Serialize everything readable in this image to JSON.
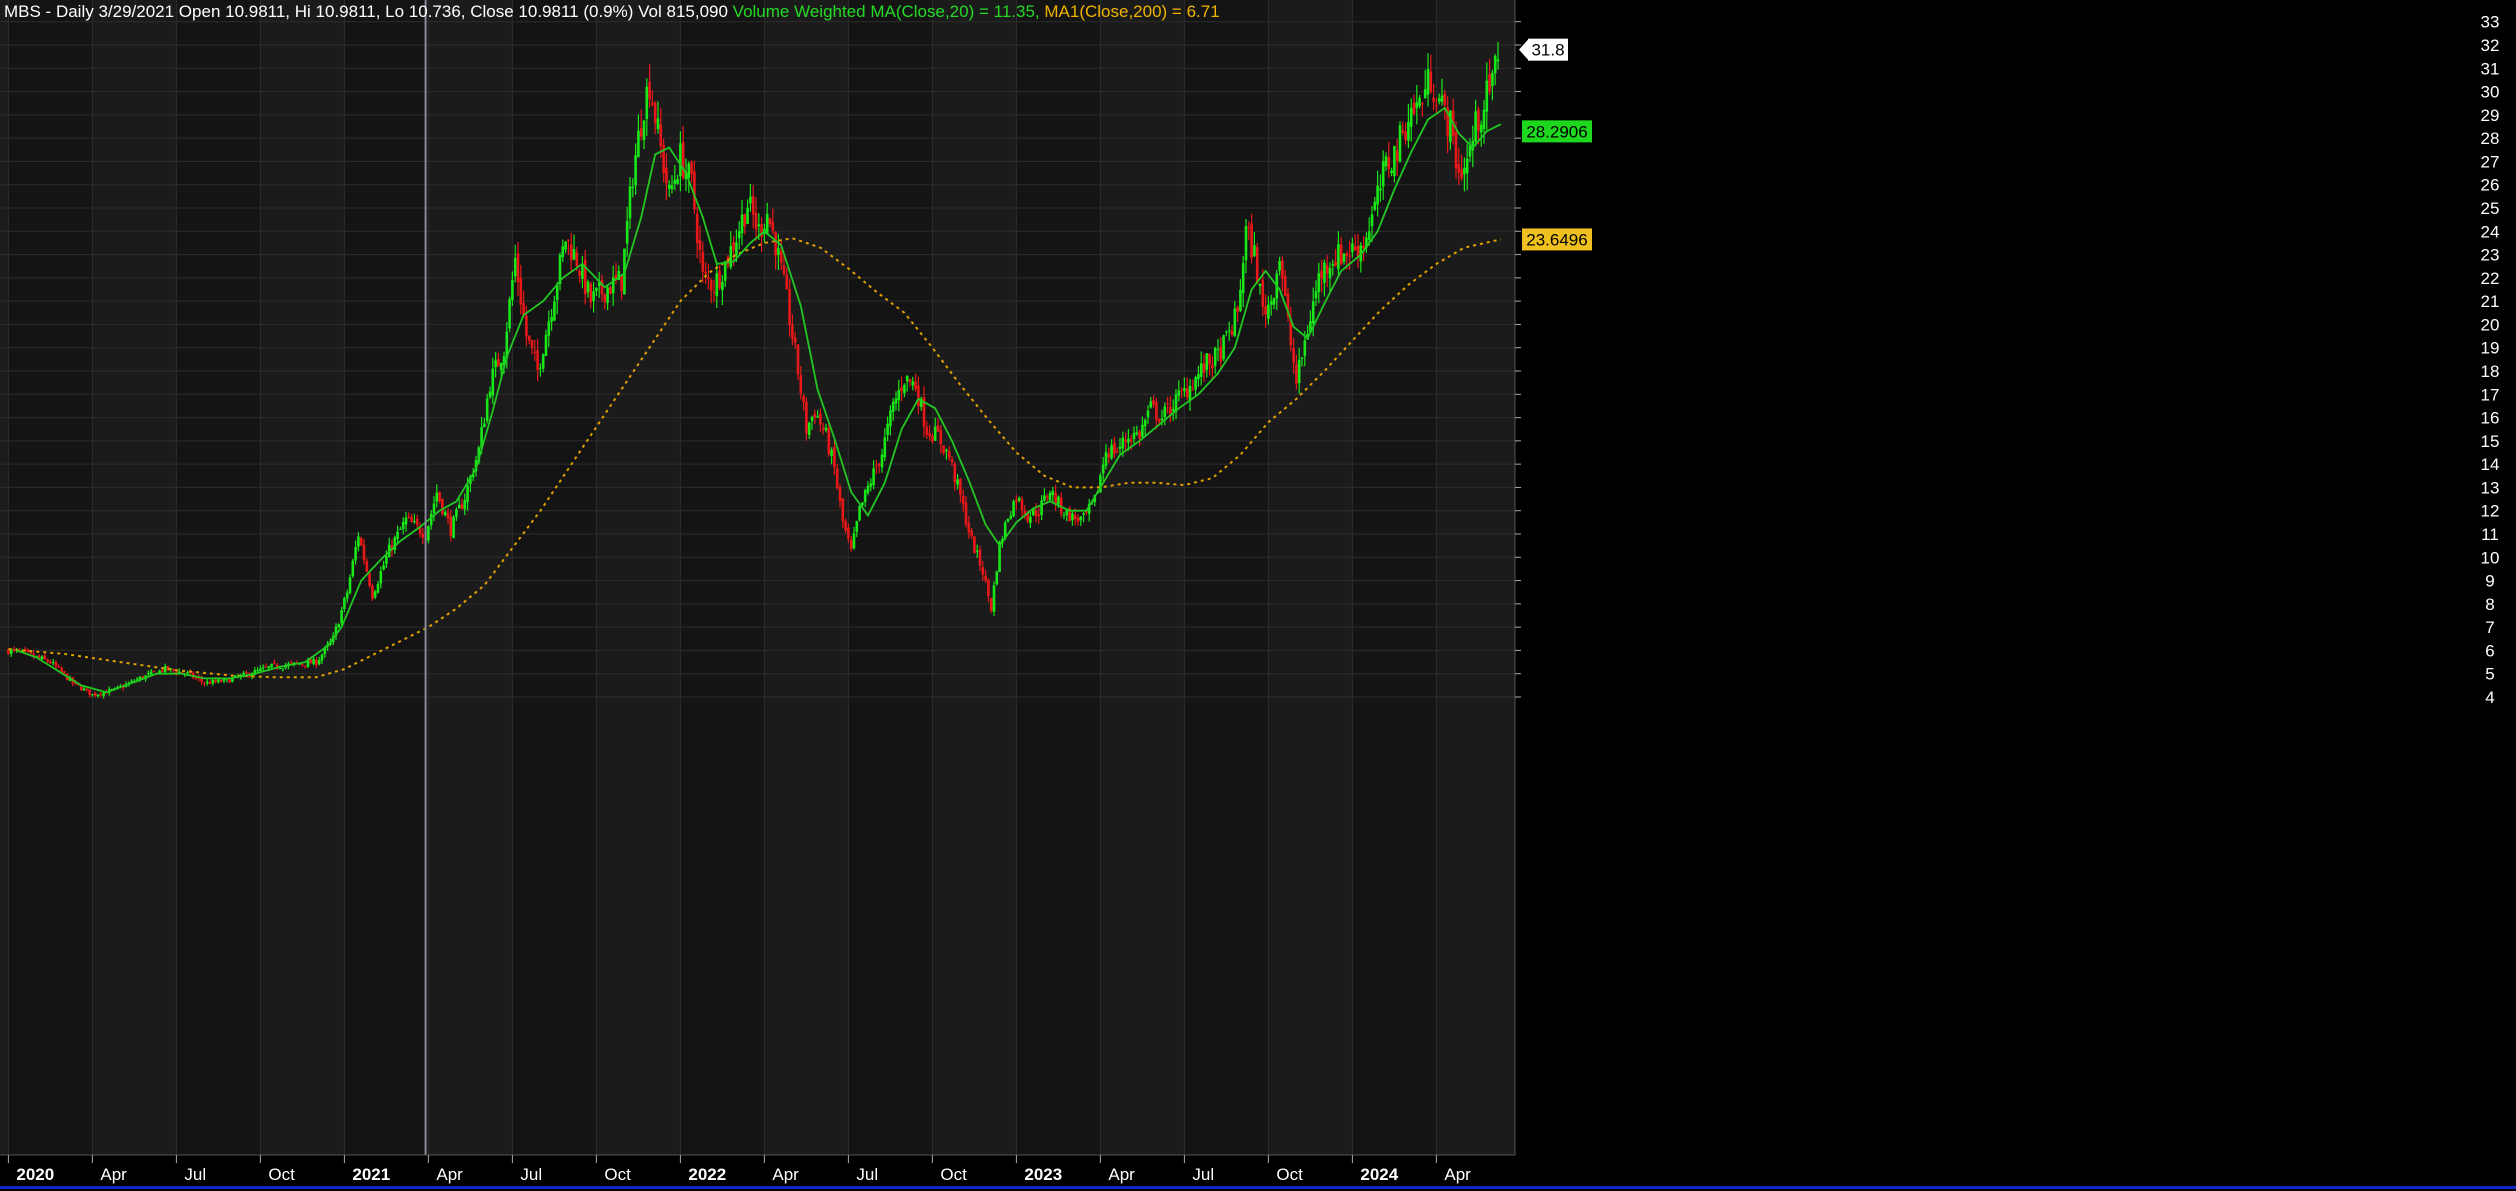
{
  "header": {
    "symbol_line": "MBS - Daily 3/29/2021 Open 10.9811, Hi 10.9811, Lo 10.736, Close 10.9811 (0.9%) Vol 815,090",
    "vwma_label": "Volume Weighted MA(Close,20)",
    "vwma_value": " = 11.35,",
    "ma_label": "MA1(Close,200)",
    "ma_value": " = 6.71"
  },
  "chart_data": {
    "type": "candlestick",
    "symbol": "MBS",
    "interval": "Daily",
    "y_ticks": [
      4,
      5,
      6,
      7,
      8,
      9,
      10,
      11,
      12,
      13,
      14,
      15,
      16,
      17,
      18,
      19,
      20,
      21,
      22,
      23,
      24,
      25,
      26,
      27,
      28,
      29,
      30,
      31,
      32,
      33
    ],
    "ylim": [
      3.3,
      33.6
    ],
    "x_tick_labels": [
      {
        "label": "2020",
        "t": 0.0,
        "major": true
      },
      {
        "label": "Apr",
        "t": 3.0,
        "major": false
      },
      {
        "label": "Jul",
        "t": 6.0,
        "major": false
      },
      {
        "label": "Oct",
        "t": 9.0,
        "major": false
      },
      {
        "label": "2021",
        "t": 12.0,
        "major": true
      },
      {
        "label": "Apr",
        "t": 15.0,
        "major": false
      },
      {
        "label": "Jul",
        "t": 18.0,
        "major": false
      },
      {
        "label": "Oct",
        "t": 21.0,
        "major": false
      },
      {
        "label": "2022",
        "t": 24.0,
        "major": true
      },
      {
        "label": "Apr",
        "t": 27.0,
        "major": false
      },
      {
        "label": "Jul",
        "t": 30.0,
        "major": false
      },
      {
        "label": "Oct",
        "t": 33.0,
        "major": false
      },
      {
        "label": "2023",
        "t": 36.0,
        "major": true
      },
      {
        "label": "Apr",
        "t": 39.0,
        "major": false
      },
      {
        "label": "Jul",
        "t": 42.0,
        "major": false
      },
      {
        "label": "Oct",
        "t": 45.0,
        "major": false
      },
      {
        "label": "2024",
        "t": 48.0,
        "major": true
      },
      {
        "label": "Apr",
        "t": 51.0,
        "major": false
      }
    ],
    "cursor_date": "3/29/2021",
    "cursor_t": 14.9,
    "price_path": [
      [
        -0.5,
        6.1
      ],
      [
        0.5,
        5.9
      ],
      [
        1.5,
        5.5
      ],
      [
        2.3,
        4.6
      ],
      [
        3.0,
        4.1
      ],
      [
        3.8,
        4.3
      ],
      [
        4.7,
        4.8
      ],
      [
        5.6,
        5.2
      ],
      [
        6.4,
        5.0
      ],
      [
        7.0,
        4.6
      ],
      [
        7.8,
        4.7
      ],
      [
        8.6,
        5.0
      ],
      [
        9.4,
        5.3
      ],
      [
        10.2,
        5.4
      ],
      [
        11.0,
        5.5
      ],
      [
        11.6,
        6.5
      ],
      [
        12.1,
        8.5
      ],
      [
        12.5,
        11.0
      ],
      [
        13.0,
        8.4
      ],
      [
        13.6,
        10.3
      ],
      [
        14.2,
        11.6
      ],
      [
        14.9,
        11.0
      ],
      [
        15.3,
        12.8
      ],
      [
        15.8,
        11.2
      ],
      [
        16.3,
        12.6
      ],
      [
        16.8,
        14.6
      ],
      [
        17.2,
        17.5
      ],
      [
        17.7,
        19.0
      ],
      [
        18.1,
        22.8
      ],
      [
        18.5,
        19.5
      ],
      [
        18.9,
        18.0
      ],
      [
        19.4,
        20.8
      ],
      [
        19.9,
        23.7
      ],
      [
        20.3,
        22.8
      ],
      [
        20.8,
        21.0
      ],
      [
        21.4,
        21.6
      ],
      [
        21.9,
        21.9
      ],
      [
        22.3,
        26.5
      ],
      [
        22.7,
        29.5
      ],
      [
        22.9,
        30.4
      ],
      [
        23.3,
        27.5
      ],
      [
        23.6,
        25.5
      ],
      [
        24.0,
        27.2
      ],
      [
        24.4,
        26.0
      ],
      [
        24.8,
        22.0
      ],
      [
        25.2,
        21.7
      ],
      [
        25.6,
        22.6
      ],
      [
        26.0,
        23.8
      ],
      [
        26.4,
        25.2
      ],
      [
        26.8,
        24.0
      ],
      [
        27.1,
        24.8
      ],
      [
        27.4,
        23.5
      ],
      [
        27.8,
        21.0
      ],
      [
        28.2,
        18.0
      ],
      [
        28.5,
        15.5
      ],
      [
        28.8,
        16.3
      ],
      [
        29.2,
        15.2
      ],
      [
        29.5,
        13.8
      ],
      [
        29.8,
        11.5
      ],
      [
        30.1,
        10.2
      ],
      [
        30.4,
        12.0
      ],
      [
        30.8,
        13.3
      ],
      [
        31.2,
        14.5
      ],
      [
        31.6,
        16.5
      ],
      [
        32.0,
        17.7
      ],
      [
        32.4,
        17.4
      ],
      [
        32.8,
        15.5
      ],
      [
        33.2,
        15.2
      ],
      [
        33.6,
        14.3
      ],
      [
        34.0,
        12.6
      ],
      [
        34.4,
        10.7
      ],
      [
        34.8,
        9.4
      ],
      [
        35.1,
        7.8
      ],
      [
        35.4,
        10.5
      ],
      [
        35.7,
        11.8
      ],
      [
        36.0,
        12.6
      ],
      [
        36.4,
        11.8
      ],
      [
        36.8,
        12.0
      ],
      [
        37.2,
        12.9
      ],
      [
        37.6,
        12.1
      ],
      [
        38.0,
        11.7
      ],
      [
        38.4,
        11.6
      ],
      [
        38.8,
        12.4
      ],
      [
        39.2,
        14.6
      ],
      [
        39.6,
        14.6
      ],
      [
        40.0,
        15.2
      ],
      [
        40.4,
        15.3
      ],
      [
        40.8,
        16.4
      ],
      [
        41.2,
        16.0
      ],
      [
        41.6,
        16.6
      ],
      [
        42.0,
        17.1
      ],
      [
        42.4,
        17.7
      ],
      [
        42.8,
        18.3
      ],
      [
        43.2,
        18.6
      ],
      [
        43.6,
        19.6
      ],
      [
        43.9,
        20.5
      ],
      [
        44.2,
        24.0
      ],
      [
        44.5,
        23.0
      ],
      [
        44.8,
        20.6
      ],
      [
        45.1,
        21.0
      ],
      [
        45.4,
        23.0
      ],
      [
        45.7,
        20.0
      ],
      [
        46.0,
        17.5
      ],
      [
        46.4,
        19.8
      ],
      [
        46.8,
        22.0
      ],
      [
        47.2,
        22.8
      ],
      [
        47.6,
        23.0
      ],
      [
        48.0,
        23.2
      ],
      [
        48.4,
        23.5
      ],
      [
        48.8,
        25.0
      ],
      [
        49.2,
        26.8
      ],
      [
        49.6,
        27.5
      ],
      [
        50.0,
        29.0
      ],
      [
        50.4,
        29.5
      ],
      [
        50.8,
        30.6
      ],
      [
        51.2,
        29.3
      ],
      [
        51.5,
        28.5
      ],
      [
        51.8,
        26.5
      ],
      [
        52.1,
        27.0
      ],
      [
        52.4,
        28.5
      ],
      [
        52.7,
        29.5
      ],
      [
        53.0,
        30.3
      ],
      [
        53.2,
        31.8
      ]
    ],
    "series": [
      {
        "name": "Volume Weighted MA(Close,20)",
        "color": "#22c822",
        "last_value": 28.2906,
        "value_label": "28.2906",
        "points": [
          [
            0.3,
            6.0
          ],
          [
            1.0,
            5.7
          ],
          [
            1.8,
            5.1
          ],
          [
            2.6,
            4.5
          ],
          [
            3.5,
            4.2
          ],
          [
            4.4,
            4.6
          ],
          [
            5.3,
            5.0
          ],
          [
            6.2,
            5.0
          ],
          [
            7.0,
            4.8
          ],
          [
            7.9,
            4.8
          ],
          [
            8.8,
            5.0
          ],
          [
            9.7,
            5.3
          ],
          [
            10.6,
            5.5
          ],
          [
            11.4,
            6.2
          ],
          [
            11.9,
            7.0
          ],
          [
            12.6,
            9.0
          ],
          [
            13.3,
            9.9
          ],
          [
            14.0,
            10.7
          ],
          [
            14.7,
            11.3
          ],
          [
            15.4,
            12.0
          ],
          [
            16.0,
            12.4
          ],
          [
            16.7,
            13.8
          ],
          [
            17.3,
            16.3
          ],
          [
            17.8,
            18.6
          ],
          [
            18.4,
            20.4
          ],
          [
            19.1,
            21.0
          ],
          [
            19.8,
            22.0
          ],
          [
            20.5,
            22.6
          ],
          [
            21.3,
            21.6
          ],
          [
            22.0,
            22.2
          ],
          [
            22.6,
            24.6
          ],
          [
            23.1,
            27.3
          ],
          [
            23.6,
            27.6
          ],
          [
            24.2,
            26.5
          ],
          [
            24.8,
            24.6
          ],
          [
            25.3,
            22.6
          ],
          [
            25.9,
            22.7
          ],
          [
            26.5,
            23.5
          ],
          [
            27.0,
            24.0
          ],
          [
            27.6,
            23.4
          ],
          [
            28.3,
            20.8
          ],
          [
            28.9,
            17.2
          ],
          [
            29.5,
            15.1
          ],
          [
            30.1,
            12.8
          ],
          [
            30.7,
            11.8
          ],
          [
            31.3,
            13.2
          ],
          [
            31.9,
            15.5
          ],
          [
            32.5,
            16.8
          ],
          [
            33.1,
            16.4
          ],
          [
            33.7,
            15.0
          ],
          [
            34.3,
            13.3
          ],
          [
            34.9,
            11.4
          ],
          [
            35.4,
            10.5
          ],
          [
            36.0,
            11.5
          ],
          [
            36.6,
            12.1
          ],
          [
            37.2,
            12.4
          ],
          [
            37.9,
            12.0
          ],
          [
            38.5,
            12.0
          ],
          [
            39.1,
            13.2
          ],
          [
            39.7,
            14.4
          ],
          [
            40.4,
            15.0
          ],
          [
            41.1,
            15.7
          ],
          [
            41.8,
            16.4
          ],
          [
            42.5,
            17.0
          ],
          [
            43.2,
            17.9
          ],
          [
            43.8,
            19.0
          ],
          [
            44.4,
            21.5
          ],
          [
            44.9,
            22.3
          ],
          [
            45.4,
            21.5
          ],
          [
            45.9,
            19.9
          ],
          [
            46.4,
            19.4
          ],
          [
            47.0,
            20.9
          ],
          [
            47.6,
            22.3
          ],
          [
            48.3,
            23.0
          ],
          [
            48.9,
            24.0
          ],
          [
            49.5,
            25.8
          ],
          [
            50.1,
            27.4
          ],
          [
            50.7,
            28.8
          ],
          [
            51.3,
            29.3
          ],
          [
            51.8,
            28.2
          ],
          [
            52.3,
            27.6
          ],
          [
            52.8,
            28.3
          ],
          [
            53.3,
            28.6
          ]
        ]
      },
      {
        "name": "MA1(Close,200)",
        "color": "#e0a000",
        "last_value": 23.6496,
        "value_label": "23.6496",
        "dashed": true,
        "points": [
          [
            0.0,
            6.05
          ],
          [
            2.0,
            5.85
          ],
          [
            4.0,
            5.5
          ],
          [
            6.0,
            5.15
          ],
          [
            8.0,
            4.92
          ],
          [
            9.5,
            4.85
          ],
          [
            11.0,
            4.85
          ],
          [
            12.0,
            5.2
          ],
          [
            13.0,
            5.8
          ],
          [
            14.0,
            6.4
          ],
          [
            15.0,
            7.0
          ],
          [
            16.0,
            7.8
          ],
          [
            17.0,
            8.8
          ],
          [
            18.0,
            10.4
          ],
          [
            19.0,
            12.0
          ],
          [
            20.0,
            13.8
          ],
          [
            21.0,
            15.6
          ],
          [
            22.0,
            17.4
          ],
          [
            23.0,
            19.2
          ],
          [
            24.0,
            21.0
          ],
          [
            25.0,
            22.2
          ],
          [
            26.0,
            23.0
          ],
          [
            27.0,
            23.5
          ],
          [
            28.0,
            23.7
          ],
          [
            29.0,
            23.3
          ],
          [
            30.0,
            22.4
          ],
          [
            31.0,
            21.4
          ],
          [
            32.0,
            20.5
          ],
          [
            33.0,
            19.0
          ],
          [
            34.0,
            17.4
          ],
          [
            35.0,
            15.9
          ],
          [
            36.0,
            14.5
          ],
          [
            37.0,
            13.5
          ],
          [
            38.0,
            13.0
          ],
          [
            39.0,
            13.0
          ],
          [
            40.0,
            13.2
          ],
          [
            41.0,
            13.2
          ],
          [
            42.0,
            13.1
          ],
          [
            43.0,
            13.4
          ],
          [
            44.0,
            14.4
          ],
          [
            45.0,
            15.8
          ],
          [
            46.0,
            16.8
          ],
          [
            47.0,
            18.0
          ],
          [
            48.0,
            19.3
          ],
          [
            49.0,
            20.6
          ],
          [
            50.0,
            21.7
          ],
          [
            51.0,
            22.6
          ],
          [
            52.0,
            23.3
          ],
          [
            53.3,
            23.65
          ]
        ]
      }
    ],
    "price_value_label": "31.8",
    "colors": {
      "up": "#18e818",
      "down": "#e81818",
      "background": "#1b1b1b",
      "band_dark": "#141414",
      "grid": "#2c2c2c",
      "axis_bg": "#000000",
      "axis_text": "#ffffff",
      "cursor": "#8a8a9a",
      "bottom_line": "#1428c8"
    }
  }
}
